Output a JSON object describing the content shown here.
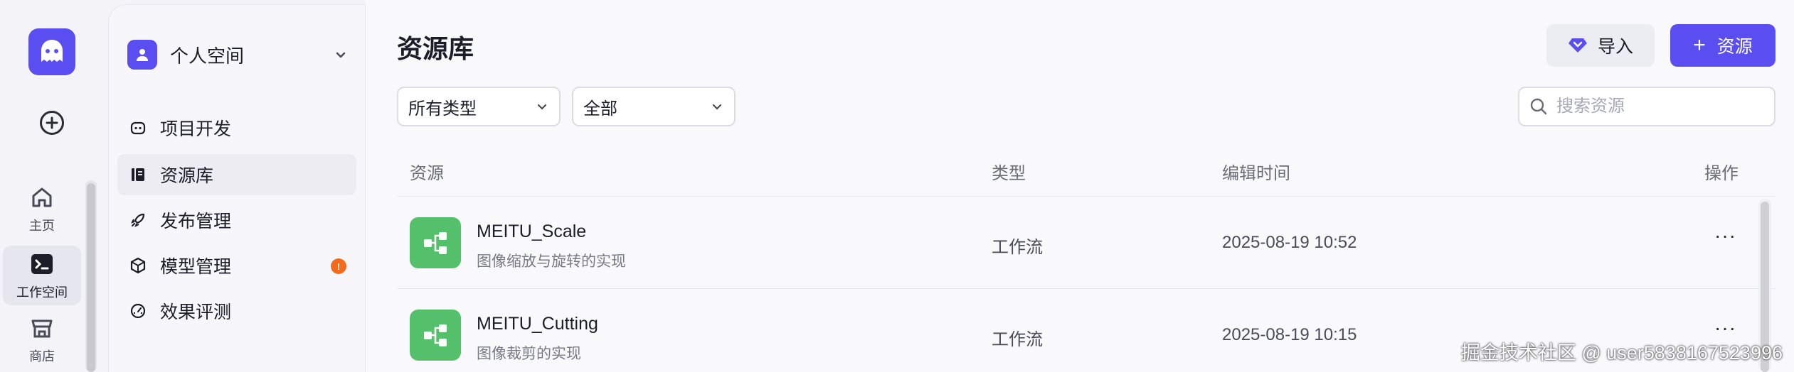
{
  "rail": {
    "items": [
      {
        "label": "主页",
        "icon": "home-icon"
      },
      {
        "label": "工作空间",
        "icon": "terminal-icon"
      },
      {
        "label": "商店",
        "icon": "store-icon"
      }
    ]
  },
  "sidebar": {
    "space_name": "个人空间",
    "items": [
      {
        "label": "项目开发",
        "icon": "bot-icon"
      },
      {
        "label": "资源库",
        "icon": "library-icon"
      },
      {
        "label": "发布管理",
        "icon": "rocket-icon"
      },
      {
        "label": "模型管理",
        "icon": "cube-icon",
        "badge": "!"
      },
      {
        "label": "效果评测",
        "icon": "gauge-icon"
      }
    ]
  },
  "main": {
    "title": "资源库",
    "import_label": "导入",
    "new_label": "资源",
    "filters": {
      "type": "所有类型",
      "scope": "全部"
    },
    "search_placeholder": "搜索资源",
    "columns": {
      "resource": "资源",
      "type": "类型",
      "edited": "编辑时间",
      "actions": "操作"
    },
    "rows": [
      {
        "name": "MEITU_Scale",
        "desc": "图像缩放与旋转的实现",
        "type": "工作流",
        "time": "2025-08-19 10:52",
        "more": "···"
      },
      {
        "name": "MEITU_Cutting",
        "desc": "图像裁剪的实现",
        "type": "工作流",
        "time": "2025-08-19 10:15",
        "more": "···"
      }
    ]
  },
  "watermark": "掘金技术社区 @ user5838167523996",
  "colors": {
    "accent": "#5b4ef0",
    "workflow_icon": "#55c06b",
    "badge": "#f26b1d"
  }
}
